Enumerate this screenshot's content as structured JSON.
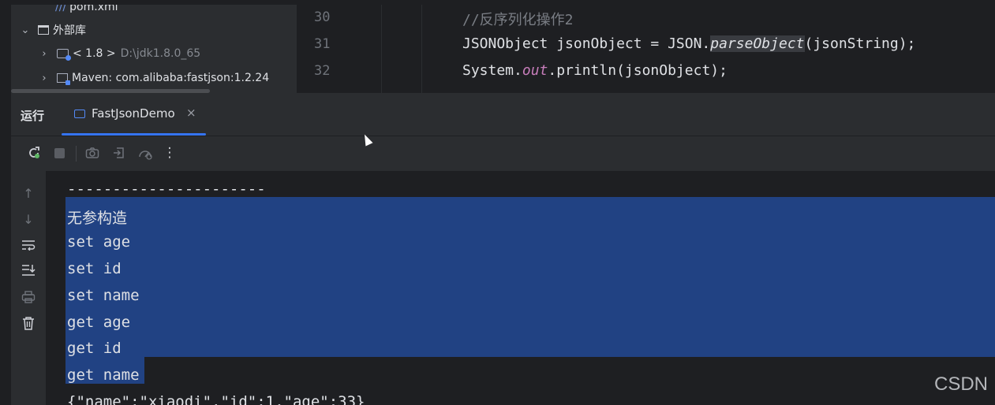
{
  "project_tree": {
    "partial_file": "pom.xml",
    "external_libraries": "外部库",
    "jdk": {
      "label": "< 1.8 >",
      "path": "D:\\jdk1.8.0_65"
    },
    "maven": "Maven: com.alibaba:fastjson:1.2.24"
  },
  "editor": {
    "lines": [
      {
        "num": "30",
        "text": "//反序列化操作2"
      },
      {
        "num": "31",
        "pre": "JSONObject jsonObject = JSON.",
        "method": "parseObject",
        "post": "(jsonString);"
      },
      {
        "num": "32",
        "pre": "System.",
        "field": "out",
        "post": ".println(jsonObject);"
      }
    ]
  },
  "run_panel": {
    "title": "运行",
    "tab_label": "FastJsonDemo",
    "close_glyph": "×"
  },
  "console": {
    "separator": "----------------------",
    "selected_lines": [
      "无参构造",
      "set age",
      "set id",
      "set name",
      "get age",
      "get id",
      "get name"
    ],
    "json_output": "{\"name\":\"xiaodi\",\"id\":1,\"age\":33}"
  },
  "watermark": "CSDN",
  "colors": {
    "accent": "#3574f0",
    "selection": "#214283",
    "background": "#1e1f22",
    "panel": "#2b2d30"
  }
}
